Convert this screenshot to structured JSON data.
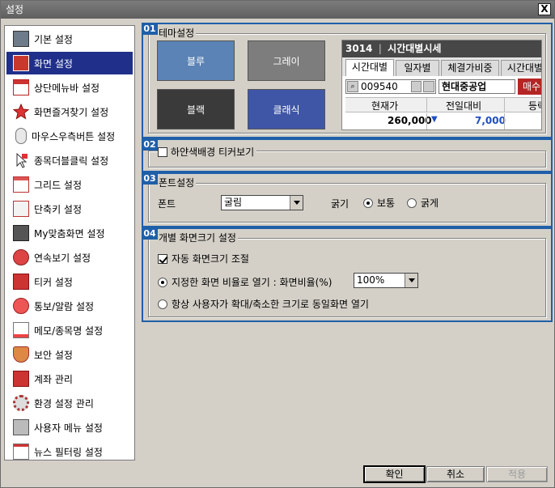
{
  "window": {
    "title": "설정",
    "close_label": "X"
  },
  "sidebar": {
    "items": [
      {
        "label": "기본 설정",
        "icon": "monitor-settings-icon"
      },
      {
        "label": "화면 설정",
        "icon": "screen-red-icon",
        "selected": true
      },
      {
        "label": "상단메뉴바 설정",
        "icon": "menubar-icon"
      },
      {
        "label": "화면즐겨찾기 설정",
        "icon": "star-icon"
      },
      {
        "label": "마우스우측버튼 설정",
        "icon": "mouse-icon"
      },
      {
        "label": "종목더블클릭 설정",
        "icon": "cursor-click-icon"
      },
      {
        "label": "그리드 설정",
        "icon": "grid-icon"
      },
      {
        "label": "단축키 설정",
        "icon": "hotkey-a-icon"
      },
      {
        "label": "My맞춤화면 설정",
        "icon": "my-screen-icon"
      },
      {
        "label": "연속보기 설정",
        "icon": "magnifier-icon"
      },
      {
        "label": "티커 설정",
        "icon": "ticker-icon"
      },
      {
        "label": "통보/알람 설정",
        "icon": "alarm-icon"
      },
      {
        "label": "메모/종목명 설정",
        "icon": "memo-icon"
      },
      {
        "label": "보안 설정",
        "icon": "shield-icon"
      },
      {
        "label": "계좌 관리",
        "icon": "account-icon"
      },
      {
        "label": "환경 설정 관리",
        "icon": "gear-icon"
      },
      {
        "label": "사용자 메뉴 설정",
        "icon": "user-menu-icon"
      },
      {
        "label": "뉴스 필터링 설정",
        "icon": "news-filter-icon"
      }
    ]
  },
  "section1": {
    "num": "01",
    "title": "테마설정",
    "themes": [
      {
        "label": "블루",
        "color": "#5b83b5"
      },
      {
        "label": "그레이",
        "color": "#7d7d7d"
      },
      {
        "label": "블랙",
        "color": "#3a3a3a"
      },
      {
        "label": "클래식",
        "color": "#3f56a6"
      }
    ],
    "preview": {
      "title_code": "3014",
      "title_text": "시간대별시세",
      "tabs": [
        "시간대별",
        "일자별",
        "체결가비중",
        "시간대별"
      ],
      "code": "009540",
      "name": "현대중공업",
      "order_btn": "매수",
      "headers": [
        "현재가",
        "전일대비",
        "등락"
      ],
      "price": "260,000",
      "change_arrow": "▼",
      "change": "7,000"
    }
  },
  "section2": {
    "num": "02",
    "checkbox_label": "하얀색배경 티커보기",
    "checked": false
  },
  "section3": {
    "num": "03",
    "title": "폰트설정",
    "font_label": "폰트",
    "font_value": "굴림",
    "weight_label": "굵기",
    "weight_normal": "보통",
    "weight_bold": "굵게"
  },
  "section4": {
    "num": "04",
    "title": "개별 화면크기 설정",
    "auto_label": "자동 화면크기 조절",
    "auto_checked": true,
    "ratio_label": "지정한 화면 비율로 열기 : 화면비율(%)",
    "ratio_value": "100%",
    "always_label": "항상 사용자가 확대/축소한 크기로 동일화면 열기"
  },
  "buttons": {
    "ok": "확인",
    "cancel": "취소",
    "apply": "적용"
  }
}
